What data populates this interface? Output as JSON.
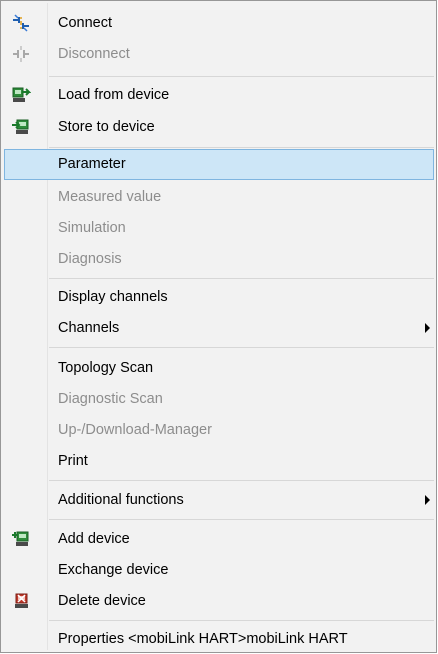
{
  "menu": {
    "connect": "Connect",
    "disconnect": "Disconnect",
    "load_from_device": "Load from device",
    "store_to_device": "Store to device",
    "parameter": "Parameter",
    "measured_value": "Measured value",
    "simulation": "Simulation",
    "diagnosis": "Diagnosis",
    "display_channels": "Display channels",
    "channels": "Channels",
    "topology_scan": "Topology Scan",
    "diagnostic_scan": "Diagnostic Scan",
    "up_download_manager": "Up-/Download-Manager",
    "print": "Print",
    "additional_functions": "Additional functions",
    "add_device": "Add device",
    "exchange_device": "Exchange device",
    "delete_device": "Delete device",
    "properties": "Properties <mobiLink HART>mobiLink HART"
  },
  "colors": {
    "menu_background": "#f2f2f2",
    "highlight_background": "#cde6f7",
    "highlight_border": "#7fb5e0",
    "disabled_text": "#8d8d8d",
    "separator": "#d7d7d7"
  },
  "icons": {
    "connect": "connect-plug-icon",
    "disconnect": "disconnect-plug-icon",
    "load_from_device": "load-from-device-icon",
    "store_to_device": "store-to-device-icon",
    "add_device": "add-device-icon",
    "delete_device": "delete-device-icon"
  }
}
